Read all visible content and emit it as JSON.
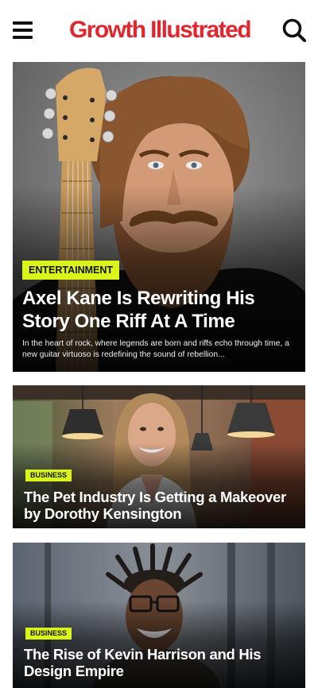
{
  "header": {
    "logo_text": "Growth Illustrated",
    "menu_icon": "hamburger-menu-icon",
    "search_icon": "search-icon"
  },
  "colors": {
    "brand_red": "#e0262e",
    "badge_lime": "#d9f51a",
    "text_white": "#ffffff"
  },
  "articles": [
    {
      "category": "ENTERTAINMENT",
      "title": "Axel Kane Is Rewriting His Story One Riff At A Time",
      "excerpt": "In the heart of rock, where legends are born and riffs echo through time, a new guitar virtuoso is redefining the sound of rebellion..."
    },
    {
      "category": "BUSINESS",
      "title": "The Pet Industry Is Getting a Makeover by Dorothy Kensington"
    },
    {
      "category": "BUSINESS",
      "title": "The Rise of Kevin Harrison and His Design Empire"
    }
  ]
}
